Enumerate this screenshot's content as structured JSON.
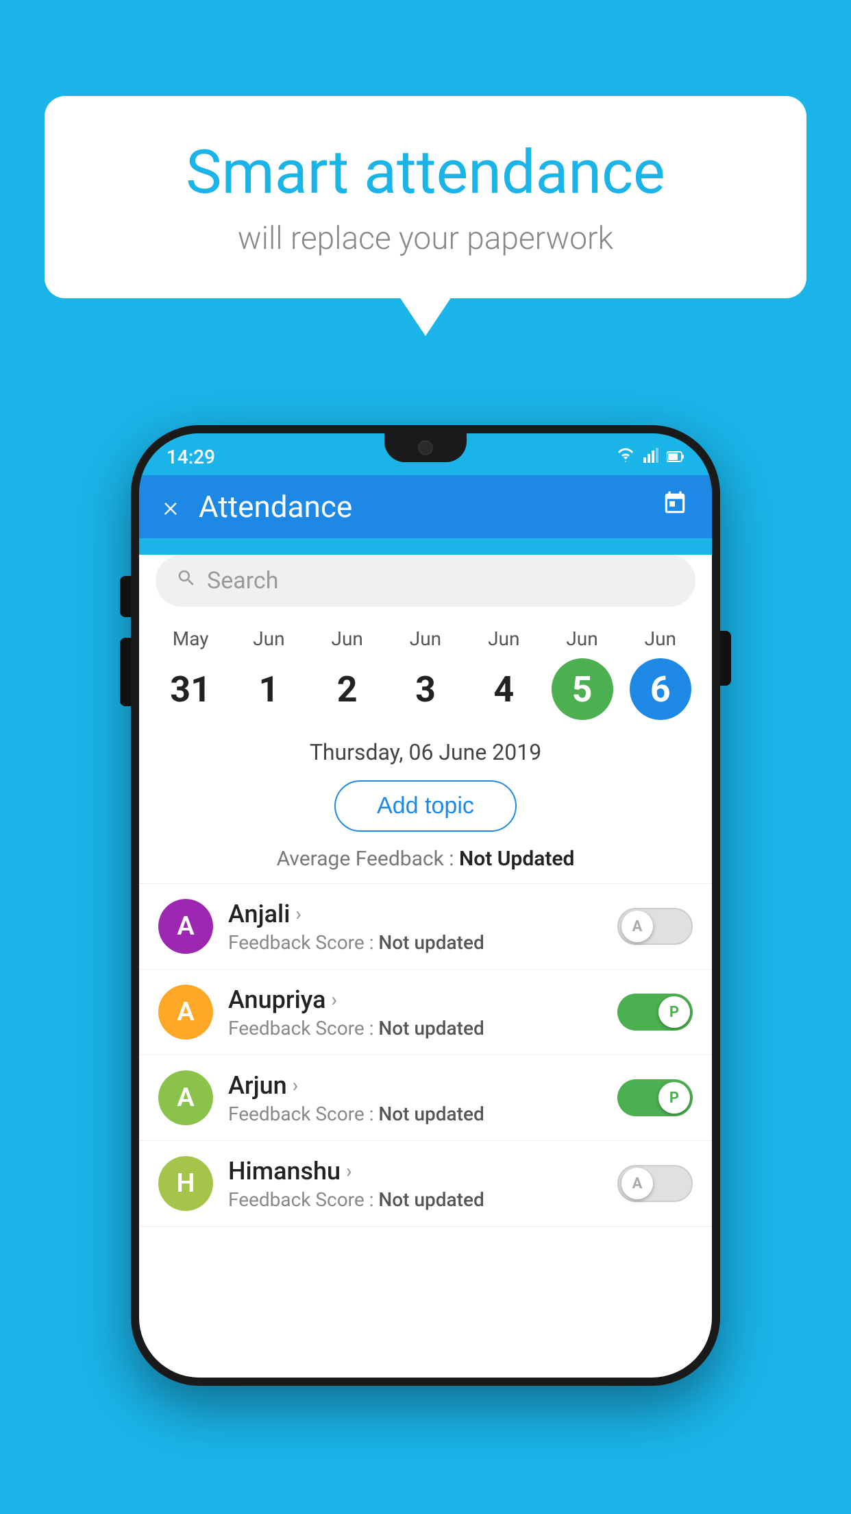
{
  "background_color": "#1ab4e8",
  "bubble": {
    "headline": "Smart attendance",
    "subtext": "will replace your paperwork"
  },
  "status_bar": {
    "time": "14:29",
    "icons": [
      "wifi",
      "signal",
      "battery"
    ]
  },
  "app_header": {
    "title": "Attendance",
    "close_label": "×",
    "calendar_icon": "📅"
  },
  "search": {
    "placeholder": "Search"
  },
  "calendar": {
    "days": [
      {
        "month": "May",
        "day": "31",
        "style": "normal"
      },
      {
        "month": "Jun",
        "day": "1",
        "style": "normal"
      },
      {
        "month": "Jun",
        "day": "2",
        "style": "normal"
      },
      {
        "month": "Jun",
        "day": "3",
        "style": "normal"
      },
      {
        "month": "Jun",
        "day": "4",
        "style": "normal"
      },
      {
        "month": "Jun",
        "day": "5",
        "style": "green"
      },
      {
        "month": "Jun",
        "day": "6",
        "style": "blue"
      }
    ],
    "selected_date": "Thursday, 06 June 2019"
  },
  "add_topic_button": "Add topic",
  "avg_feedback_label": "Average Feedback :",
  "avg_feedback_value": "Not Updated",
  "students": [
    {
      "name": "Anjali",
      "initial": "A",
      "avatar_color": "#9c27b0",
      "feedback": "Not updated",
      "toggle": "off",
      "toggle_label": "A"
    },
    {
      "name": "Anupriya",
      "initial": "A",
      "avatar_color": "#ffa726",
      "feedback": "Not updated",
      "toggle": "on",
      "toggle_label": "P"
    },
    {
      "name": "Arjun",
      "initial": "A",
      "avatar_color": "#8bc34a",
      "feedback": "Not updated",
      "toggle": "on",
      "toggle_label": "P"
    },
    {
      "name": "Himanshu",
      "initial": "H",
      "avatar_color": "#a5c44a",
      "feedback": "Not updated",
      "toggle": "off",
      "toggle_label": "A"
    }
  ],
  "labels": {
    "feedback_score": "Feedback Score :"
  }
}
